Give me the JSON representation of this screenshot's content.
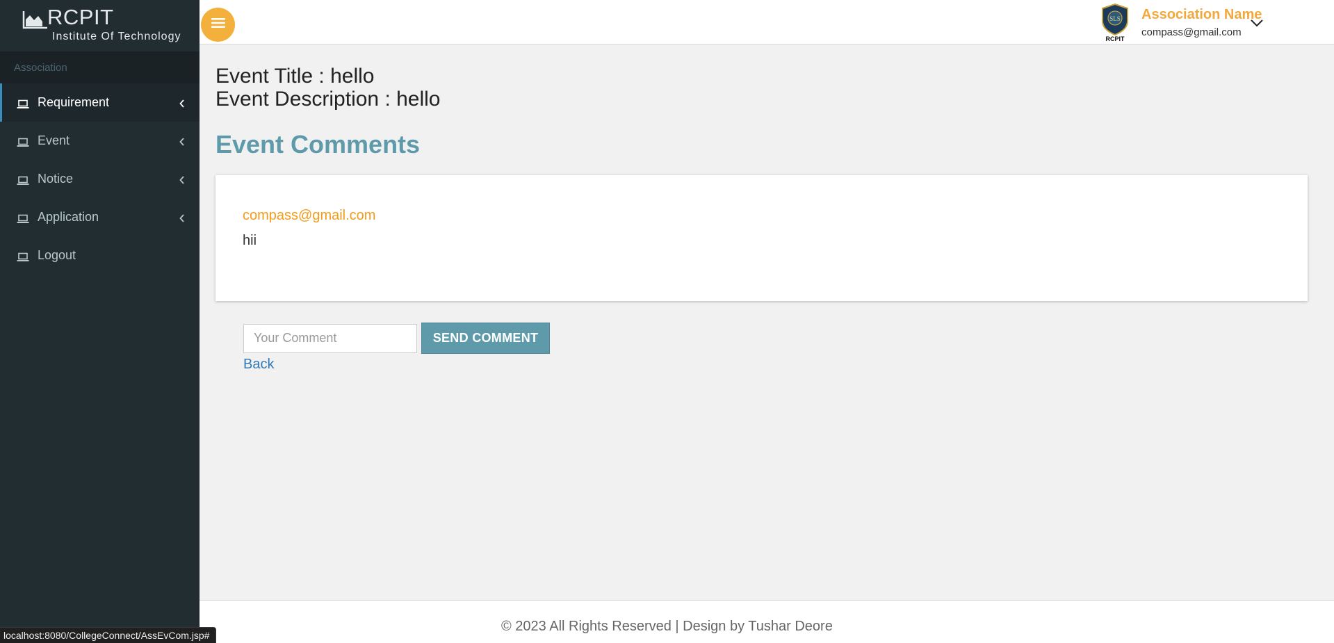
{
  "brand": {
    "name": "RCPIT",
    "subtitle": "Institute Of Technology"
  },
  "sidebar": {
    "section_label": "Association",
    "items": [
      {
        "label": "Requirement",
        "active": true,
        "has_submenu": true
      },
      {
        "label": "Event",
        "active": false,
        "has_submenu": true
      },
      {
        "label": "Notice",
        "active": false,
        "has_submenu": true
      },
      {
        "label": "Application",
        "active": false,
        "has_submenu": true
      },
      {
        "label": "Logout",
        "active": false,
        "has_submenu": false
      }
    ]
  },
  "header": {
    "menu_toggle_icon": "hamburger-icon",
    "user": {
      "name": "Association Name",
      "email": "compass@gmail.com",
      "logo_text": "RCPIT"
    }
  },
  "event": {
    "title": "Event Title : hello",
    "description": "Event Description : hello"
  },
  "comments": {
    "heading": "Event Comments",
    "items": [
      {
        "user": "compass@gmail.com",
        "text": "hii"
      }
    ]
  },
  "form": {
    "placeholder": "Your Comment",
    "value": "",
    "send_label": "SEND COMMENT",
    "back_label": "Back"
  },
  "footer": {
    "text": "© 2023 All Rights Reserved | Design by Tushar Deore"
  },
  "status_bar": {
    "url": "localhost:8080/CollegeConnect/AssEvCom.jsp#"
  },
  "colors": {
    "sidebar_bg": "#222d32",
    "accent_orange": "#f3b03d",
    "heading_teal": "#5f9aab",
    "link_blue": "#337ab7"
  }
}
